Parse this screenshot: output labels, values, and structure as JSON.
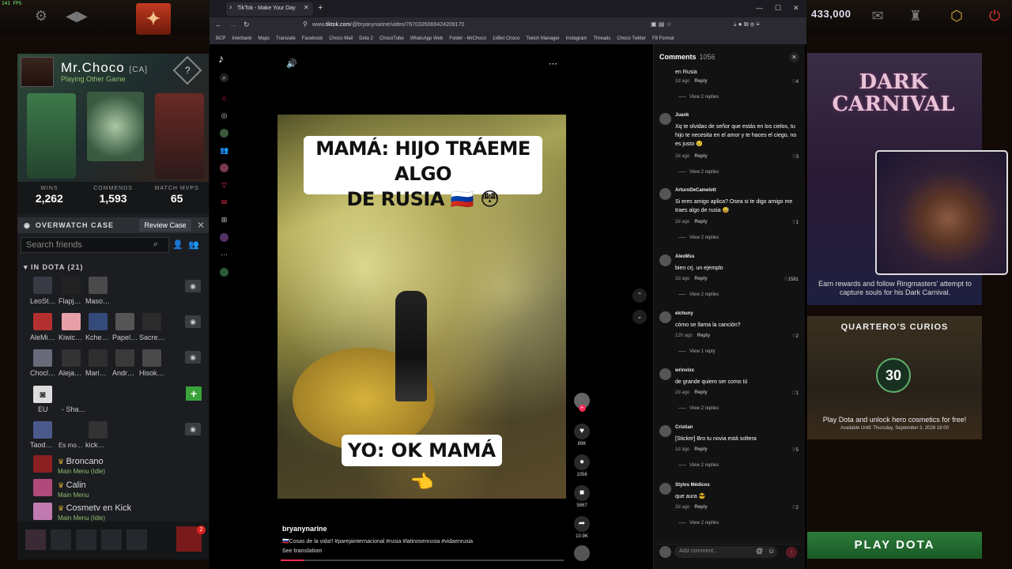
{
  "fps": "141 FPS",
  "dota": {
    "shards": "433,000",
    "profile": {
      "name": "Mr.Choco",
      "tag": "[CA]",
      "status": "Playing Other Game",
      "rank": "?"
    },
    "stats": [
      {
        "label": "WINS",
        "value": "2,262"
      },
      {
        "label": "COMMENDS",
        "value": "1,593"
      },
      {
        "label": "MATCH MVPS",
        "value": "65"
      }
    ],
    "overwatch": {
      "label": "OVERWATCH CASE",
      "review": "Review Case"
    },
    "search_placeholder": "Search friends",
    "in_dota": "IN DOTA (21)",
    "friend_grid": [
      [
        "LeoSt…",
        "Flapj…",
        "Maso…"
      ],
      [
        "AleMi…",
        "Kiwic…",
        "Kche…",
        "Papel…",
        "Sacre…"
      ],
      [
        "Chocl…",
        "Aleja…",
        "Mari…",
        "Andr…",
        "Hisok…"
      ],
      [
        "EU",
        "- Sha…"
      ],
      [
        "Taod…",
        "Es mo…",
        "kick…"
      ]
    ],
    "friend_list": [
      {
        "name": "Broncano",
        "status": "Main Menu (Idle)"
      },
      {
        "name": "Calin",
        "status": "Main Menu"
      },
      {
        "name": "Cosmetv en Kick",
        "status": "Main Menu (Idle)"
      }
    ],
    "notification_count": "2",
    "carnival": {
      "title": "DARK CARNIVAL",
      "desc": "Earn rewards and follow Ringmasters' attempt to capture souls for his Dark Carnival."
    },
    "curios": {
      "title": "QUARTERO'S CURIOS",
      "badge": "30",
      "desc": "Play Dota and unlock hero cosmetics for free!",
      "avail": "Available Until:  Thursday, September 3, 2026 18:00"
    },
    "play": "PLAY DOTA"
  },
  "browser": {
    "tab_title": "TikTok - Make Your Day",
    "url_prefix": "www.",
    "url_host": "tiktok.com",
    "url_path": "/@bryanynarine/video/7670335069424209170",
    "bookmarks": [
      "BCP",
      "Interbank",
      "Maps",
      "Translate",
      "Facebook",
      "Choco Mail",
      "Dota 2",
      "ChocoTube",
      "WhatsApp Web",
      "Folder - MrChoco",
      "1xBet Choco",
      "Twitch Manager",
      "Instagram",
      "Threads",
      "Choco Twitter",
      "F8 Format"
    ]
  },
  "tiktok": {
    "caption_top_line1": "MAMÁ: HIJO TRÁEME ALGO",
    "caption_top_line2": "DE RUSIA 🇷🇺 😳",
    "caption_bottom": "YO: OK MAMÁ 👈",
    "actions": [
      {
        "icon": "heart-icon",
        "glyph": "♥",
        "count": "89K"
      },
      {
        "icon": "comment-icon",
        "glyph": "●",
        "count": "1056"
      },
      {
        "icon": "bookmark-icon",
        "glyph": "■",
        "count": "5867"
      },
      {
        "icon": "share-icon",
        "glyph": "➦",
        "count": "10.9K"
      }
    ],
    "author": "bryanynarine",
    "caption": "🇷🇺Cosas de la vida!! #parejainternacional #rusia #latinosenrusia #vidaenrusia",
    "see_translation": "See translation",
    "progress": 0.08,
    "comments_title": "Comments",
    "comments_count": "1056",
    "add_comment_placeholder": "Add comment...",
    "comments": [
      {
        "user": "",
        "text": "en Rusia",
        "date": "2d ago",
        "likes": "4",
        "replies": "View 2 replies"
      },
      {
        "user": "Juank",
        "text": "Xq te olvidas de señor que estás en los cielos, tu hijo te necesita en el amor y te haces el ciego, no es justo 😢",
        "date": "2d ago",
        "likes": "3",
        "replies": "View 2 replies"
      },
      {
        "user": "ArturoDeCamelott",
        "text": "Si eres amigo aplica? Osea si te digo amigo me traes algo de rusia 😅",
        "date": "2d ago",
        "likes": "1",
        "replies": "View 2 replies"
      },
      {
        "user": "AlexMss",
        "text": "bien crj. un ejemplo",
        "date": "2d ago",
        "likes": "1581",
        "replies": "View 2 replies"
      },
      {
        "user": "elchuny",
        "text": "cómo se llama la canción?",
        "date": "12h ago",
        "likes": "2",
        "replies": "View 1 reply"
      },
      {
        "user": "wrinvixx",
        "text": "de grande quiero ser como tú",
        "date": "2d ago",
        "likes": "1",
        "replies": "View 2 replies"
      },
      {
        "user": "Cristian",
        "text": "[Sticker] Bro tu novia está soltera",
        "date": "1d ago",
        "likes": "5",
        "replies": "View 2 replies"
      },
      {
        "user": "Stylos Médicos",
        "text": "que aura 😎",
        "date": "2d ago",
        "likes": "2",
        "replies": "View 2 replies"
      }
    ],
    "reply_label": "Reply"
  }
}
